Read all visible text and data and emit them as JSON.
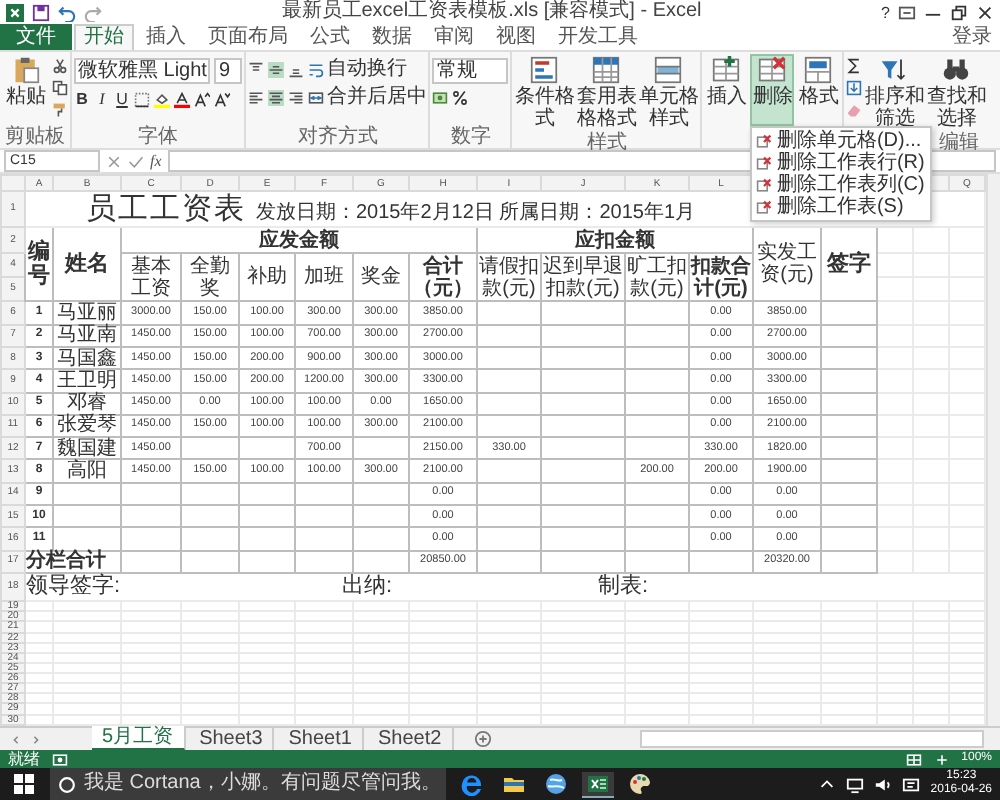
{
  "window": {
    "title": "最新员工excel工资表模板.xls [兼容模式] - Excel",
    "help": "?"
  },
  "ribbon_tabs": [
    {
      "label": "文件",
      "kind": "file",
      "selected": false
    },
    {
      "label": "开始",
      "kind": "tab",
      "selected": true
    },
    {
      "label": "插入",
      "kind": "tab",
      "selected": false
    },
    {
      "label": "页面布局",
      "kind": "tab",
      "selected": false
    },
    {
      "label": "公式",
      "kind": "tab",
      "selected": false
    },
    {
      "label": "数据",
      "kind": "tab",
      "selected": false
    },
    {
      "label": "审阅",
      "kind": "tab",
      "selected": false
    },
    {
      "label": "视图",
      "kind": "tab",
      "selected": false
    },
    {
      "label": "开发工具",
      "kind": "tab",
      "selected": false
    }
  ],
  "sign_in": "登录",
  "ribbon": {
    "clipboard": {
      "paste": "粘贴",
      "label": "剪贴板"
    },
    "font": {
      "name": "微软雅黑 Light",
      "size": "9",
      "bold": "B",
      "italic": "I",
      "underline": "U",
      "label": "字体"
    },
    "alignment": {
      "wrap_text": "自动换行",
      "merge_center": "合并后居中",
      "label": "对齐方式"
    },
    "number": {
      "format": "常规",
      "label": "数字"
    },
    "groups": [
      {
        "label": "样式",
        "buttons": [
          {
            "label": "条件格式",
            "selected": false
          },
          {
            "label": "套用表格格式",
            "selected": false
          },
          {
            "label": "单元格样式",
            "selected": false
          }
        ]
      },
      {
        "buttons": [
          {
            "label": "插入",
            "selected": false
          },
          {
            "label": "删除",
            "selected": true
          },
          {
            "label": "格式",
            "selected": false
          }
        ]
      },
      {
        "label": "编辑",
        "buttons": [
          {
            "label": "排序和筛选",
            "selected": false
          },
          {
            "label": "查找和选择",
            "selected": false
          }
        ]
      }
    ]
  },
  "delete_menu": {
    "items": [
      "删除单元格(D)...",
      "删除工作表行(R)",
      "删除工作表列(C)",
      "删除工作表(S)"
    ]
  },
  "formula_bar": {
    "name_box": "C15",
    "fx": "fx"
  },
  "columns": [
    "A",
    "B",
    "C",
    "D",
    "E",
    "F",
    "G",
    "H",
    "I",
    "J",
    "K",
    "L",
    null,
    null,
    null,
    null,
    "Q"
  ],
  "sheet": {
    "title_row": {
      "row_number": "1",
      "title": "员工工资表",
      "dates": "发放日期：2015年2月12日 所属日期：2015年1月"
    },
    "header_row_numbers": [
      "2",
      "4",
      "5"
    ],
    "header": {
      "number": "编号",
      "name": "姓名",
      "gross": "应发金额",
      "gross_columns": [
        "基本工资",
        "全勤奖",
        "补助",
        "加班",
        "奖金",
        "合计（元）"
      ],
      "deductions": "应扣金额",
      "deduction_columns": [
        "请假扣款(元)",
        "迟到早退扣款(元)",
        "旷工扣款(元)",
        "扣款合计(元)"
      ],
      "net": "实发工资(元)",
      "signature": "签字"
    },
    "rows": [
      {
        "row_number": "6",
        "number": "1",
        "name": "马亚丽",
        "cells": [
          "3000.00",
          "150.00",
          "100.00",
          "300.00",
          "300.00",
          "3850.00",
          null,
          null,
          null,
          "0.00",
          "3850.00"
        ]
      },
      {
        "row_number": "7",
        "number": "2",
        "name": "马亚南",
        "cells": [
          "1450.00",
          "150.00",
          "100.00",
          "700.00",
          "300.00",
          "2700.00",
          null,
          null,
          null,
          "0.00",
          "2700.00"
        ]
      },
      {
        "row_number": "8",
        "number": "3",
        "name": "马国鑫",
        "cells": [
          "1450.00",
          "150.00",
          "200.00",
          "900.00",
          "300.00",
          "3000.00",
          null,
          null,
          null,
          "0.00",
          "3000.00"
        ]
      },
      {
        "row_number": "9",
        "number": "4",
        "name": "王卫明",
        "cells": [
          "1450.00",
          "150.00",
          "200.00",
          "1200.00",
          "300.00",
          "3300.00",
          null,
          null,
          null,
          "0.00",
          "3300.00"
        ]
      },
      {
        "row_number": "10",
        "number": "5",
        "name": "邓睿",
        "cells": [
          "1450.00",
          "0.00",
          "100.00",
          "100.00",
          "0.00",
          "1650.00",
          null,
          null,
          null,
          "0.00",
          "1650.00"
        ]
      },
      {
        "row_number": "11",
        "number": "6",
        "name": "张爱琴",
        "cells": [
          "1450.00",
          "150.00",
          "100.00",
          "100.00",
          "300.00",
          "2100.00",
          null,
          null,
          null,
          "0.00",
          "2100.00"
        ]
      },
      {
        "row_number": "12",
        "number": "7",
        "name": "魏国建",
        "cells": [
          "1450.00",
          null,
          null,
          "700.00",
          null,
          "2150.00",
          "330.00",
          null,
          null,
          "330.00",
          "1820.00"
        ]
      },
      {
        "row_number": "13",
        "number": "8",
        "name": "高阳",
        "cells": [
          "1450.00",
          "150.00",
          "100.00",
          "100.00",
          "300.00",
          "2100.00",
          null,
          null,
          "200.00",
          "200.00",
          "1900.00"
        ]
      },
      {
        "row_number": "14",
        "number": "9",
        "cells": [
          null,
          null,
          null,
          null,
          null,
          "0.00",
          null,
          null,
          null,
          "0.00",
          "0.00"
        ]
      },
      {
        "row_number": "15",
        "number": "10",
        "cells": [
          null,
          null,
          null,
          null,
          null,
          "0.00",
          null,
          null,
          null,
          "0.00",
          "0.00"
        ]
      },
      {
        "row_number": "16",
        "number": "11",
        "cells": [
          null,
          null,
          null,
          null,
          null,
          "0.00",
          null,
          null,
          null,
          "0.00",
          "0.00"
        ]
      }
    ],
    "total_row": {
      "row_number": "17",
      "label": "分栏合计",
      "gross_total": "20850.00",
      "net_total": "20320.00"
    },
    "signature_row": {
      "row_number": "18",
      "labels": [
        "领导签字:",
        "出纳:",
        "制表:"
      ]
    },
    "empty_row_numbers": [
      "19",
      "20",
      "21",
      "22",
      "23",
      "24",
      "25",
      "26",
      "27",
      "28",
      "29",
      "30"
    ]
  },
  "sheet_tabs": [
    {
      "label": "5月工资",
      "selected": true
    },
    {
      "label": "Sheet3",
      "selected": false
    },
    {
      "label": "Sheet1",
      "selected": false
    },
    {
      "label": "Sheet2",
      "selected": false
    }
  ],
  "status_bar": {
    "status": "就绪",
    "zoom": "100%"
  },
  "taskbar": {
    "search_placeholder": "我是 Cortana，小娜。有问题尽管问我。",
    "time": "15:23",
    "date": "2016-04-26"
  }
}
